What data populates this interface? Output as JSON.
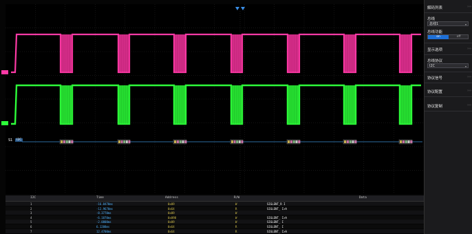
{
  "panel": {
    "title": "解码列表",
    "bus_label": "总线",
    "bus_value": "总线1",
    "bus_function_label": "总线功能",
    "toggle_on": "on",
    "toggle_off": "off",
    "display_options": "显示选项",
    "bus_protocol_label": "总线协议",
    "bus_protocol_value": "I2C",
    "protocol_signal": "协议信号",
    "protocol_config": "协议配置",
    "protocol_copy": "协议复制"
  },
  "channels": {
    "ch1_color": "#ff3aa6",
    "ch2_color": "#2dff3a",
    "bus_label": "S1",
    "bus_tag": "I2C"
  },
  "table": {
    "headers": [
      "I2C",
      "Time",
      "Address",
      "R/W",
      "Data"
    ],
    "rows": [
      [
        "1",
        "-16.8470ms",
        "0x09",
        "W",
        "SIGLENT_R I"
      ],
      [
        "2",
        "-12.9670ms",
        "0x64",
        "R",
        "SIGLENT_ I>A"
      ],
      [
        "3",
        "-8.3770ms",
        "0x09",
        "W",
        ""
      ],
      [
        "4",
        "-6.1870ms",
        "0x098",
        "W",
        "SIGLENT_ I>A"
      ],
      [
        "5",
        "-2.0800ms",
        "0x09",
        "W",
        "SIGLENT_ I"
      ],
      [
        "6",
        "6.1208ms",
        "0x64",
        "R",
        "SIGLENT_ I"
      ],
      [
        "7",
        "12.4700ms",
        "0x64",
        "R",
        "SIGLENT_ I>A"
      ]
    ]
  }
}
